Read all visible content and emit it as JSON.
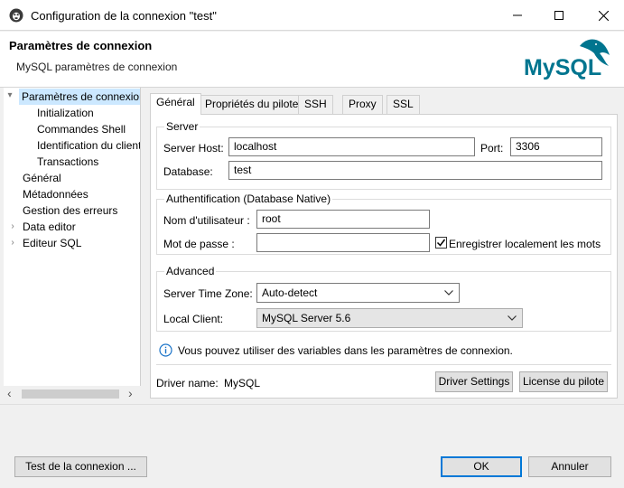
{
  "window": {
    "title": "Configuration de la connexion \"test\"",
    "minimize_label": "—",
    "maximize_label": "☐",
    "close_label": "✕"
  },
  "header": {
    "title": "Paramètres de connexion",
    "subtitle": "MySQL paramètres de connexion",
    "logo_text": "MySQL"
  },
  "sidebar": {
    "items": [
      {
        "label": "Paramètres de connexion",
        "expanded": true,
        "selected": true
      },
      {
        "label": "Initialization"
      },
      {
        "label": "Commandes Shell"
      },
      {
        "label": "Identification du client"
      },
      {
        "label": "Transactions"
      },
      {
        "label": "Général"
      },
      {
        "label": "Métadonnées"
      },
      {
        "label": "Gestion des erreurs"
      },
      {
        "label": "Data editor",
        "expandable": true
      },
      {
        "label": "Editeur SQL",
        "expandable": true
      }
    ],
    "scroll_left": "‹",
    "scroll_right": "›"
  },
  "tabs": [
    {
      "label": "Général",
      "active": true
    },
    {
      "label": "Propriétés du pilote"
    },
    {
      "label": "SSH"
    },
    {
      "label": "Proxy"
    },
    {
      "label": "SSL"
    }
  ],
  "server": {
    "legend": "Server",
    "host_label": "Server Host:",
    "host_value": "localhost",
    "port_label": "Port:",
    "port_value": "3306",
    "database_label": "Database:",
    "database_value": "test"
  },
  "auth": {
    "legend": "Authentification (Database Native)",
    "username_label": "Nom d'utilisateur :",
    "username_value": "root",
    "password_label": "Mot de passe :",
    "password_value": "",
    "save_locally_label": "Enregistrer localement les mots de passe",
    "save_locally_checked": true
  },
  "advanced": {
    "legend": "Advanced",
    "timezone_label": "Server Time Zone:",
    "timezone_value": "Auto-detect",
    "local_client_label": "Local Client:",
    "local_client_value": "MySQL Server 5.6"
  },
  "info": {
    "text": "Vous pouvez utiliser des variables dans les paramètres de connexion."
  },
  "driver": {
    "name_label": "Driver name:",
    "name_value": "MySQL",
    "settings_button": "Driver Settings",
    "license_button": "License du pilote"
  },
  "footer": {
    "test_button": "Test de la connexion ...",
    "ok_button": "OK",
    "cancel_button": "Annuler"
  },
  "colors": {
    "mysql_blue": "#00758f",
    "mysql_orange": "#f29111",
    "selection": "#cce8ff",
    "primary_border": "#0078d7"
  }
}
